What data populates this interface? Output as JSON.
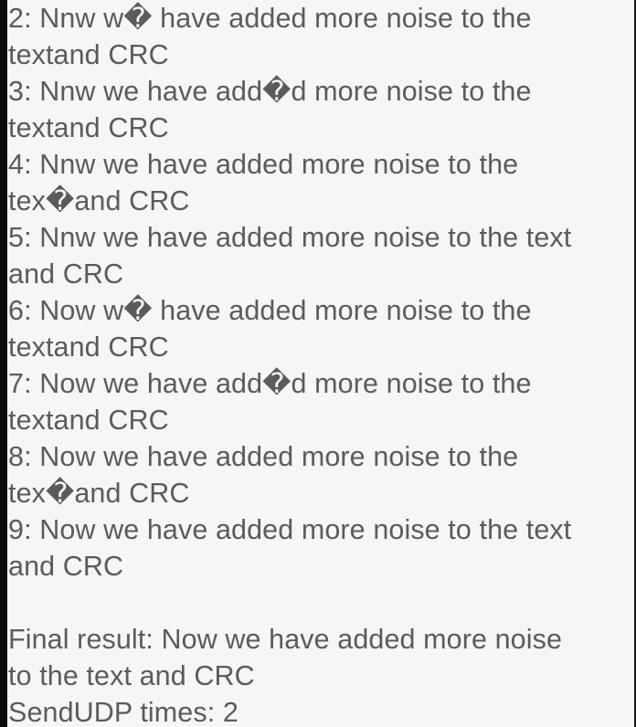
{
  "log": {
    "lines": [
      "2: Nnw w� have added more noise to the",
      "textand CRC",
      "3: Nnw we have add�d more noise to the",
      "textand CRC",
      "4: Nnw we have added more noise to the",
      "tex�and CRC",
      "5: Nnw we have added more noise to the text",
      "and CRC",
      "6: Now w� have added more noise to the",
      "textand CRC",
      "7: Now we have add�d more noise to the",
      "textand CRC",
      "8: Now we have added more noise to the",
      "tex�and CRC",
      "9: Now we have added more noise to the text",
      "and CRC"
    ],
    "final_result_line1": "Final result: Now we have added more noise",
    "final_result_line2": "to the text and CRC",
    "send_udp_times": "SendUDP times: 2"
  }
}
